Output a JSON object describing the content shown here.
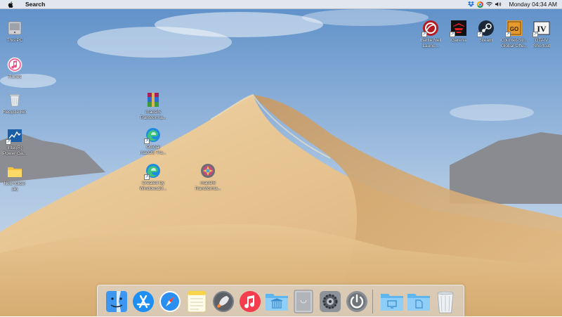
{
  "menubar": {
    "search_label": "Search",
    "clock": "Monday 04:34 AM"
  },
  "desktop": {
    "left_icons": [
      {
        "label": "This PC",
        "icon": "this-pc-icon"
      },
      {
        "label": "iTunes",
        "icon": "itunes-icon"
      },
      {
        "label": "Recycle Bin",
        "icon": "recycle-bin-icon"
      },
      {
        "label": "Intel(R)\nPower Ga...",
        "icon": "intel-power-gadget-icon"
      },
      {
        "label": "New folder\n(4)",
        "icon": "folder-icon"
      }
    ],
    "middle_icons": [
      {
        "label": "macOS\nTransforma...",
        "icon": "winrar-archive-icon"
      },
      {
        "label": "Official\nmacOS Tra...",
        "icon": "edge-icon"
      },
      {
        "label": "Created by\nWindows10...",
        "icon": "edge-icon"
      },
      {
        "label": "macOS\nTransforma...",
        "icon": "macos-transformation-pack-icon"
      }
    ],
    "right_icons": [
      {
        "label": "Battle.Net\nLaunc...",
        "icon": "battle-net-icon"
      },
      {
        "label": "Garena",
        "icon": "garena-icon"
      },
      {
        "label": "Steam",
        "icon": "steam-icon"
      },
      {
        "label": "Counter-Str...\nGlobal Offe...",
        "icon": "csgo-icon"
      },
      {
        "label": "GTAIV\nShortcut",
        "icon": "gta-iv-icon"
      }
    ]
  },
  "dock": {
    "items": [
      "finder-icon",
      "app-store-icon",
      "safari-icon",
      "notes-icon",
      "launchpad-icon",
      "music-icon",
      "applications-folder-icon",
      "mac-pro-icon",
      "system-preferences-icon",
      "power-icon",
      "desktop-folder-icon",
      "documents-folder-icon",
      "trash-icon"
    ]
  },
  "colors": {
    "sky_top": "#5d8fc8",
    "sky_bottom": "#c9d9e8",
    "sand_light": "#e6c394",
    "sand_dark": "#b58552"
  }
}
